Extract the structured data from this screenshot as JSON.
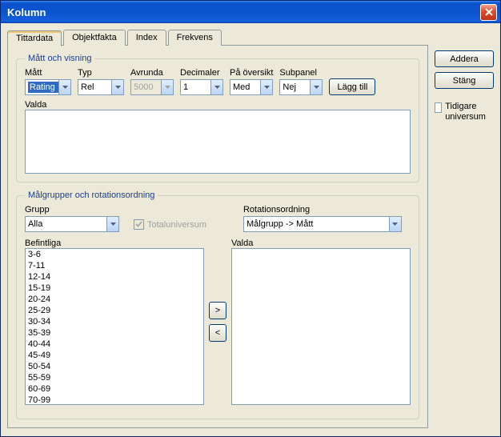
{
  "window": {
    "title": "Kolumn"
  },
  "tabs": [
    {
      "label": "Tittardata"
    },
    {
      "label": "Objektfakta"
    },
    {
      "label": "Index"
    },
    {
      "label": "Frekvens"
    }
  ],
  "fieldset1": {
    "legend": "Mått och visning",
    "matt": {
      "label": "Mått",
      "value": "Rating"
    },
    "typ": {
      "label": "Typ",
      "value": "Rel"
    },
    "avrunda": {
      "label": "Avrunda",
      "value": "5000"
    },
    "decimaler": {
      "label": "Decimaler",
      "value": "1"
    },
    "oversikt": {
      "label": "På översikt",
      "value": "Med"
    },
    "subpanel": {
      "label": "Subpanel",
      "value": "Nej"
    },
    "laggtill": "Lägg till",
    "valda_label": "Valda"
  },
  "fieldset2": {
    "legend": "Målgrupper och rotationsordning",
    "grupp": {
      "label": "Grupp",
      "value": "Alla"
    },
    "totaluniversum": "Totaluniversum",
    "rotation": {
      "label": "Rotationsordning",
      "value": "Målgrupp -> Mått"
    },
    "befintliga_label": "Befintliga",
    "valda_label": "Valda",
    "befintliga": [
      "3-6",
      "7-11",
      "12-14",
      "15-19",
      "20-24",
      "25-29",
      "30-34",
      "35-39",
      "40-44",
      "45-49",
      "50-54",
      "55-59",
      "60-69",
      "70-99"
    ],
    "move_right": ">",
    "move_left": "<"
  },
  "sidebar": {
    "addera": "Addera",
    "stang": "Stäng",
    "tidigare": "Tidigare universum"
  }
}
